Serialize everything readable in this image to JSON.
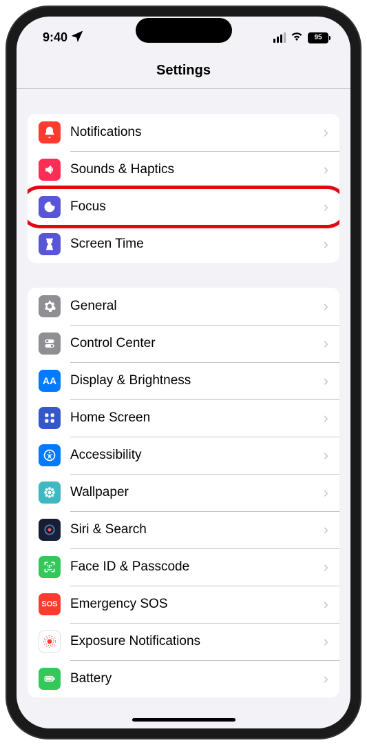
{
  "status": {
    "time": "9:40",
    "battery": "95"
  },
  "header": {
    "title": "Settings"
  },
  "sections": [
    {
      "rows": [
        {
          "label": "Notifications"
        },
        {
          "label": "Sounds & Haptics"
        },
        {
          "label": "Focus"
        },
        {
          "label": "Screen Time"
        }
      ]
    },
    {
      "rows": [
        {
          "label": "General"
        },
        {
          "label": "Control Center"
        },
        {
          "label": "Display & Brightness"
        },
        {
          "label": "Home Screen"
        },
        {
          "label": "Accessibility"
        },
        {
          "label": "Wallpaper"
        },
        {
          "label": "Siri & Search"
        },
        {
          "label": "Face ID & Passcode"
        },
        {
          "label": "Emergency SOS"
        },
        {
          "label": "Exposure Notifications"
        },
        {
          "label": "Battery"
        }
      ]
    }
  ],
  "highlighted_row": "Focus"
}
